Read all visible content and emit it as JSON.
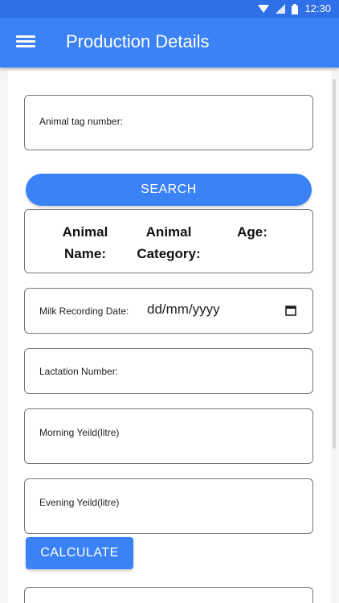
{
  "status_bar": {
    "time": "12:30",
    "icons": [
      "wifi-icon",
      "signal-icon",
      "battery-icon"
    ]
  },
  "app_bar": {
    "title": "Production Details",
    "menu_icon": "hamburger-menu-icon",
    "color": "#3b82f6"
  },
  "form": {
    "animal_tag_label": "Animal tag number:",
    "search_label": "SEARCH",
    "info": {
      "name_label_1": "Animal",
      "name_label_2": "Name:",
      "category_label_1": "Animal",
      "category_label_2": "Category:",
      "age_label": "Age:"
    },
    "milk_date_label": "Milk Recording Date:",
    "milk_date_value": "dd/mm/yyyy",
    "calendar_icon": "calendar-icon",
    "lactation_label": "Lactation Number:",
    "morning_label": "Morning Yeild(litre)",
    "evening_label": "Evening Yeild(litre)",
    "calculate_label": "CALCULATE"
  }
}
